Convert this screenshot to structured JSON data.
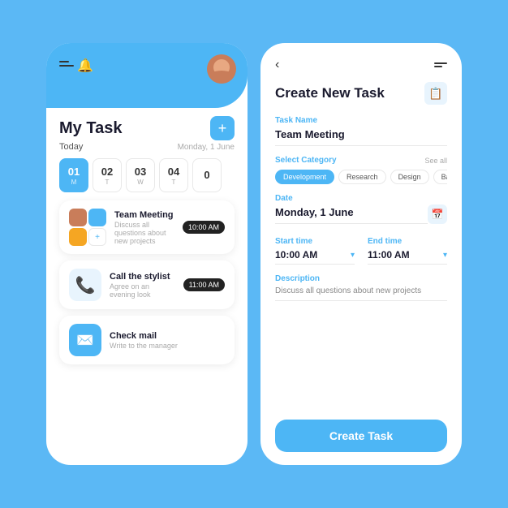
{
  "left_phone": {
    "title": "My Task",
    "add_label": "+",
    "today": "Today",
    "date": "Monday, 1 June",
    "dates": [
      {
        "number": "01",
        "day": "M",
        "active": true
      },
      {
        "number": "02",
        "day": "T",
        "active": false
      },
      {
        "number": "03",
        "day": "W",
        "active": false
      },
      {
        "number": "04",
        "day": "T",
        "active": false
      },
      {
        "number": "0",
        "day": "",
        "active": false
      }
    ],
    "tasks": [
      {
        "title": "Team Meeting",
        "desc": "Discuss all questions about new projects",
        "time": "10:00 AM",
        "type": "avatars"
      },
      {
        "title": "Call the stylist",
        "desc": "Agree on an evening look",
        "time": "11:00 AM",
        "type": "icon",
        "icon": "📞"
      },
      {
        "title": "Check mail",
        "desc": "Write to the manager",
        "time": "",
        "type": "icon",
        "icon": "✉️"
      }
    ]
  },
  "right_phone": {
    "header_title": "Create New Task",
    "back_label": "‹",
    "task_name_label": "Task Name",
    "task_name_value": "Team Meeting",
    "category_label": "Select Category",
    "see_all": "See all",
    "categories": [
      {
        "name": "Development",
        "active": true
      },
      {
        "name": "Research",
        "active": false
      },
      {
        "name": "Design",
        "active": false
      },
      {
        "name": "Backend",
        "active": false
      }
    ],
    "date_label": "Date",
    "date_value": "Monday, 1 June",
    "start_time_label": "Start time",
    "start_time_value": "10:00 AM",
    "end_time_label": "End time",
    "end_time_value": "11:00 AM",
    "description_label": "Description",
    "description_value": "Discuss all questions  about new projects",
    "create_btn": "Create Task"
  }
}
